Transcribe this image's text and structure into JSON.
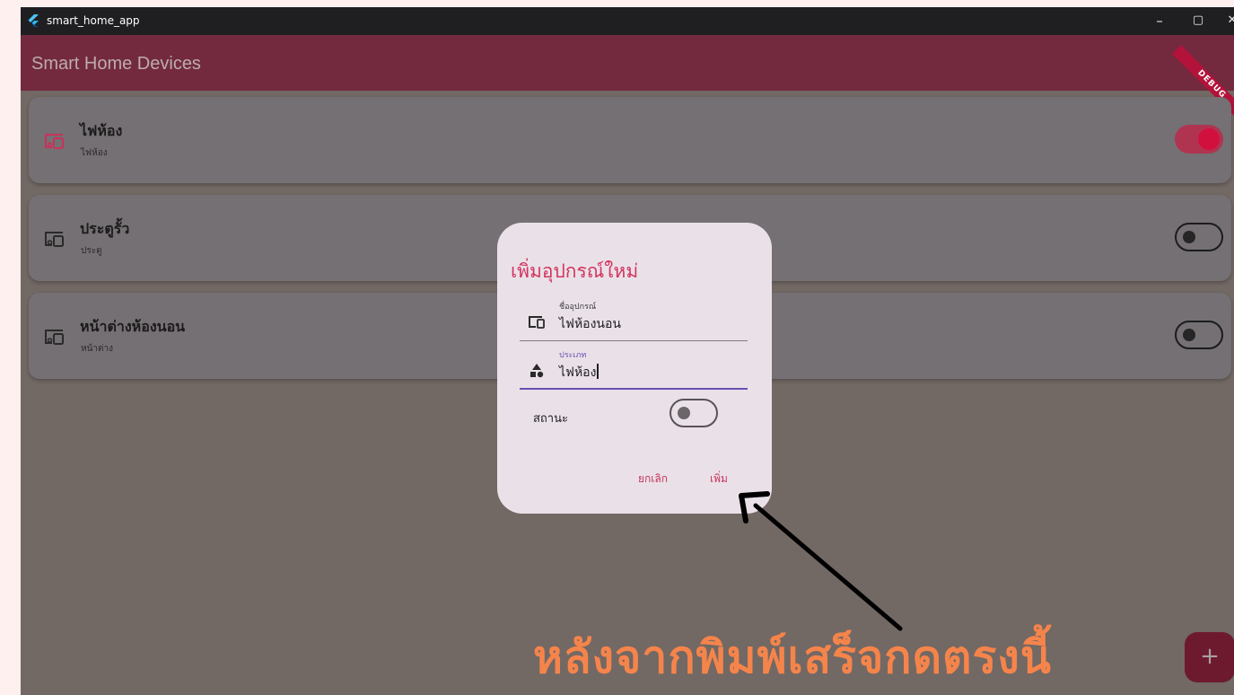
{
  "window": {
    "title": "smart_home_app",
    "controls": {
      "minimize": "–",
      "maximize": "▢",
      "close": "✕"
    }
  },
  "appbar": {
    "title": "Smart Home Devices",
    "debug_banner": "DEBUG"
  },
  "devices": [
    {
      "name": "ไฟห้อง",
      "type": "ไฟห้อง",
      "icon": "devices-icon",
      "on": true
    },
    {
      "name": "ประตูรั้ว",
      "type": "ประตู",
      "icon": "devices-icon",
      "on": false
    },
    {
      "name": "หน้าต่างห้องนอน",
      "type": "หน้าต่าง",
      "icon": "devices-icon",
      "on": false
    }
  ],
  "dialog": {
    "title": "เพิ่มอุปกรณ์ใหม่",
    "name_field": {
      "label": "ชื่ออุปกรณ์",
      "value": "ไฟห้องนอน",
      "icon": "devices-icon"
    },
    "type_field": {
      "label": "ประเภท",
      "value": "ไฟห้อง",
      "icon": "category-icon"
    },
    "status_label": "สถานะ",
    "status_on": false,
    "cancel_label": "ยกเลิก",
    "add_label": "เพิ่ม"
  },
  "fab": {
    "label": "+"
  },
  "annotation": {
    "caption": "หลังจากพิมพ์เสร็จกดตรงนี้"
  },
  "colors": {
    "primary": "#d2345f",
    "appbar": "#732a3e",
    "caption": "#f5844b",
    "focus": "#6b4fb3"
  }
}
